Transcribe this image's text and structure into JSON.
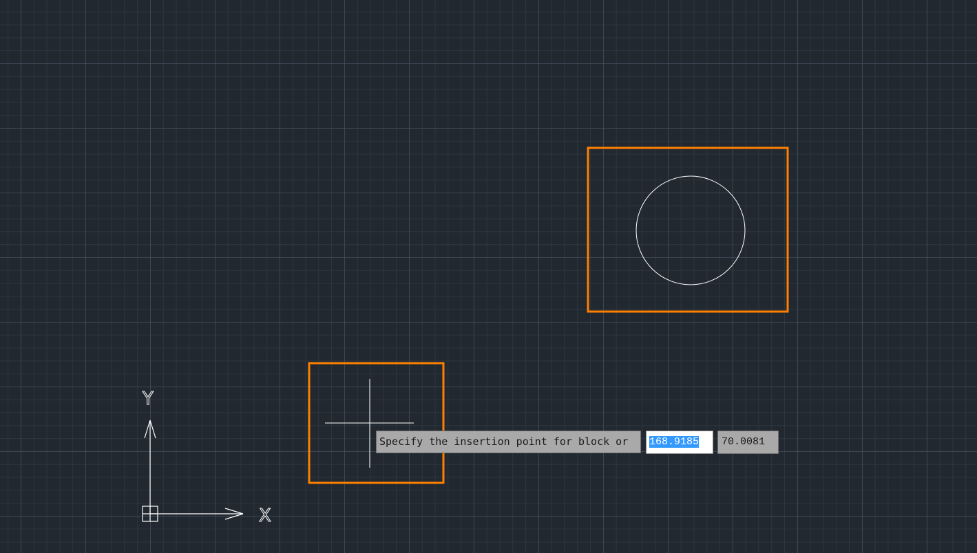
{
  "app": {
    "name": "CAD drawing area"
  },
  "colors": {
    "background": "#212830",
    "highlight": "#ff8000",
    "geometry": "#ffffff",
    "selection": "#3399ff"
  },
  "ucs": {
    "x_label": "X",
    "y_label": "Y"
  },
  "dynamic_input": {
    "prompt": "Specify the insertion point for block or",
    "x_value": "168.9185",
    "y_value": "70.0081"
  },
  "icons": {
    "crosshair": "crosshair-cursor-icon",
    "ucs": "ucs-axis-icon"
  }
}
